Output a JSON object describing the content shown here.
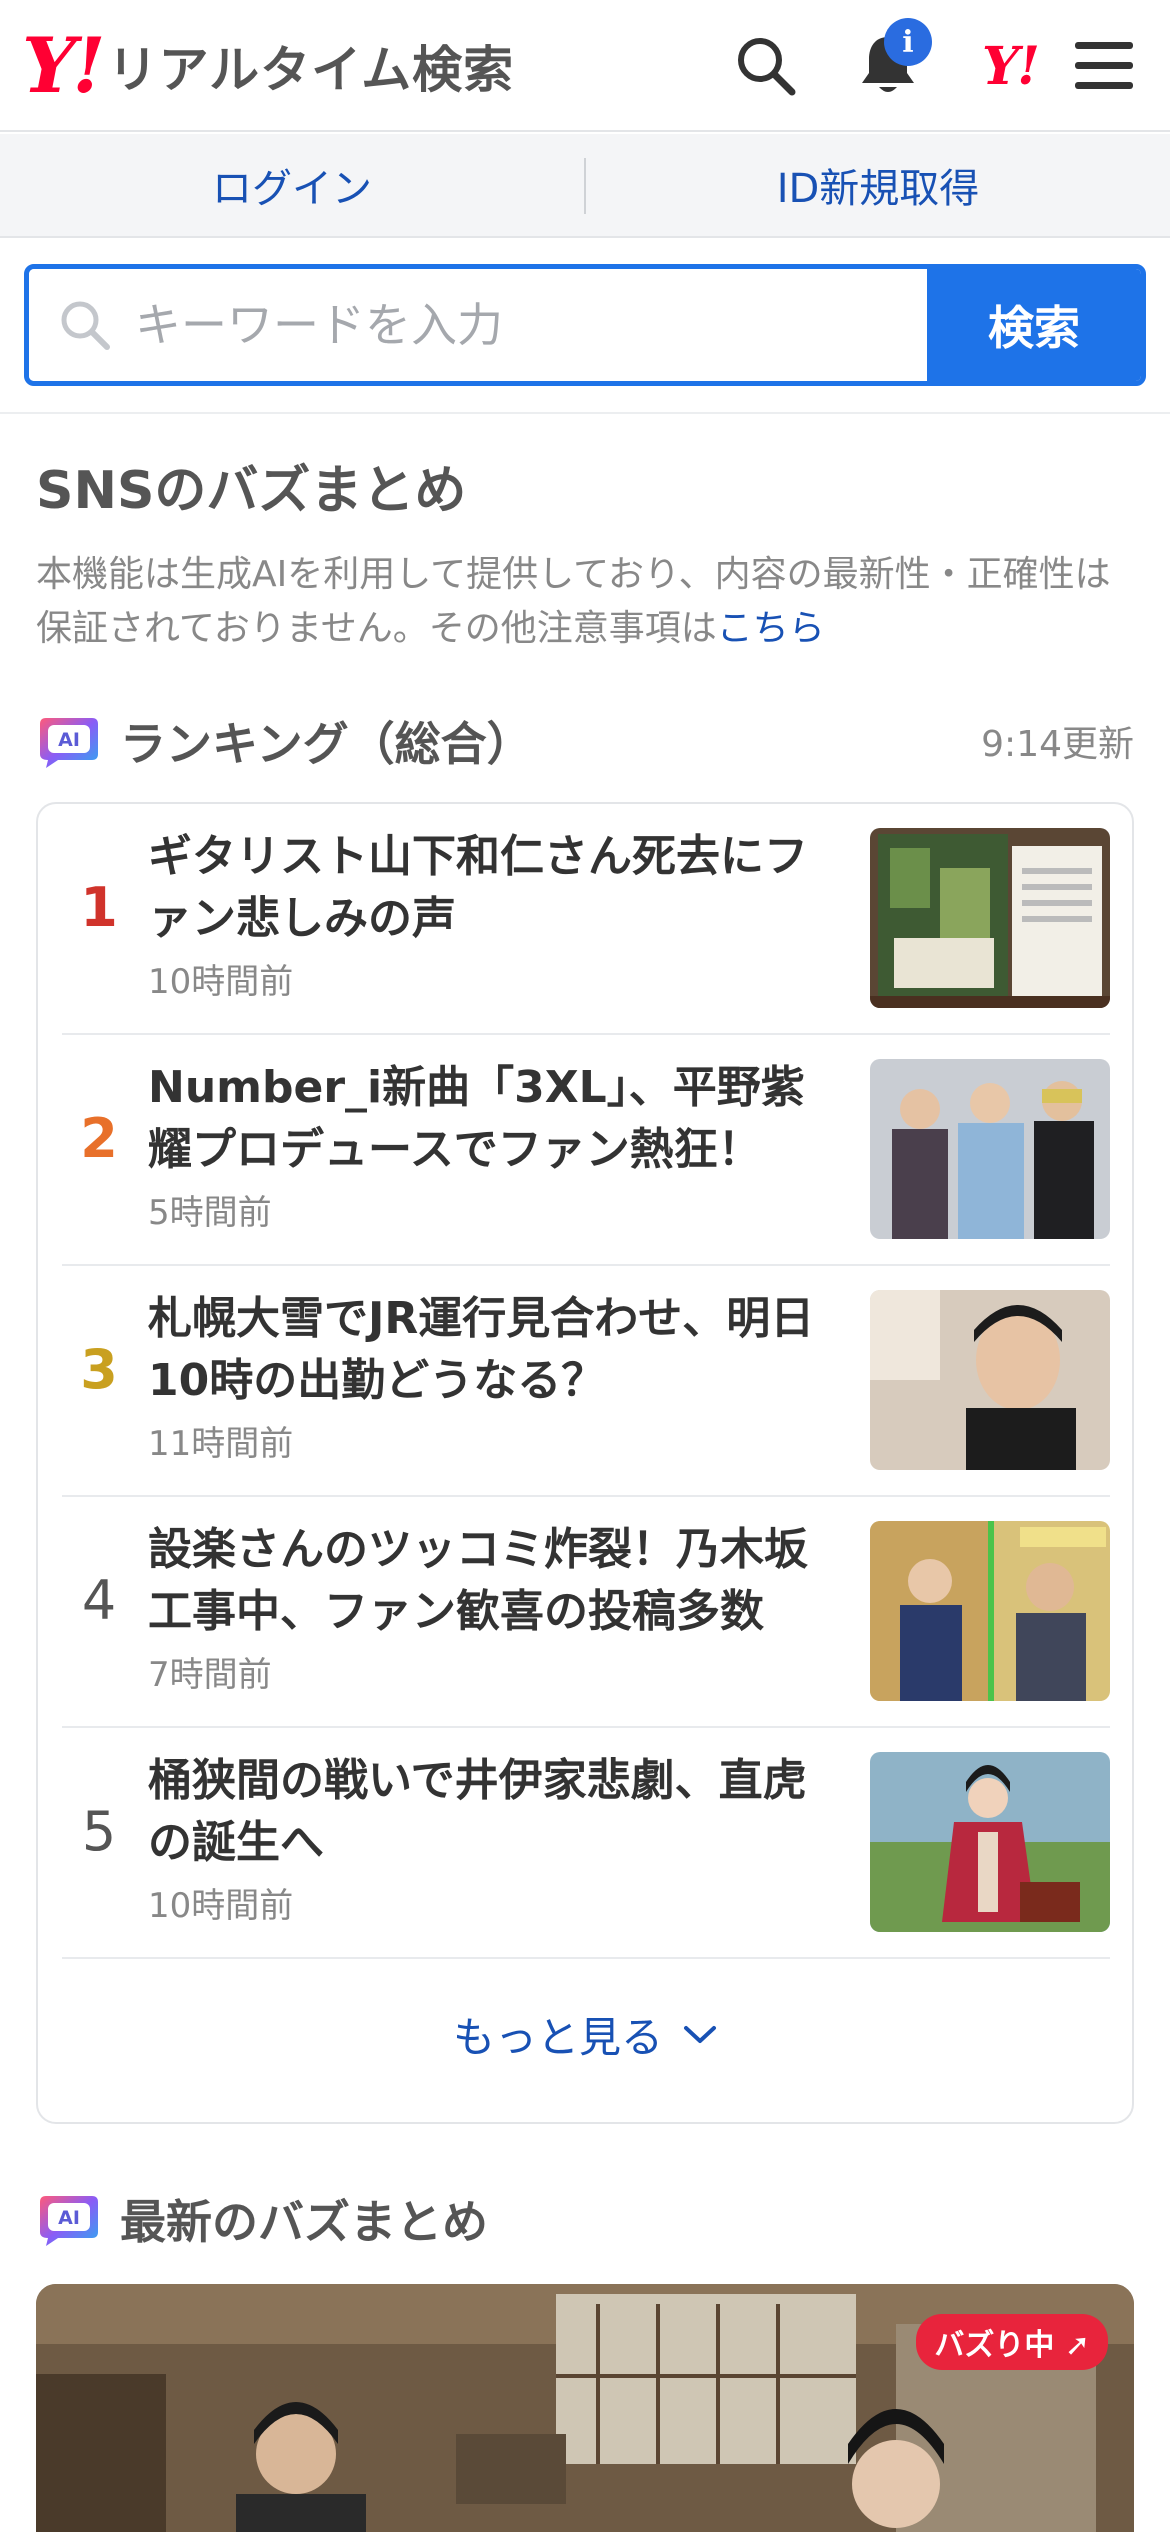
{
  "header": {
    "logo_mark": "Y!",
    "title": "リアルタイム検索",
    "notification_badge": "i",
    "yahoo_mark": "Y!"
  },
  "loginbar": {
    "login": "ログイン",
    "register": "ID新規取得"
  },
  "search": {
    "placeholder": "キーワードを入力",
    "button": "検索"
  },
  "section": {
    "title": "SNSのバズまとめ",
    "disclaimer": "本機能は生成AIを利用して提供しており、内容の最新性・正確性は保証されておりません。その他注意事項は",
    "disclaimer_link": "こちら"
  },
  "ranking": {
    "badge": "AI",
    "title": "ランキング（総合）",
    "updated": "9:14更新",
    "items": [
      {
        "rank": "1",
        "title": "ギタリスト山下和仁さん死去にファン悲しみの声",
        "time": "10時間前",
        "rank_color": "#d0332b"
      },
      {
        "rank": "2",
        "title": "Number_i新曲「3XL」、平野紫耀プロデュースでファン熱狂！",
        "time": "5時間前",
        "rank_color": "#e8702a"
      },
      {
        "rank": "3",
        "title": "札幌大雪でJR運行見合わせ、明日10時の出勤どうなる？",
        "time": "11時間前",
        "rank_color": "#c9a020"
      },
      {
        "rank": "4",
        "title": "設楽さんのツッコミ炸裂！乃木坂工事中、ファン歓喜の投稿多数",
        "time": "7時間前",
        "rank_color": "#555555"
      },
      {
        "rank": "5",
        "title": "桶狭間の戦いで井伊家悲劇、直虎の誕生へ",
        "time": "10時間前",
        "rank_color": "#555555"
      }
    ],
    "more": "もっと見る"
  },
  "latest": {
    "badge": "AI",
    "title": "最新のバズまとめ",
    "buzz_label": "バズり中"
  },
  "colors": {
    "brand_red": "#ff0033",
    "accent_blue": "#1e73e8",
    "link_blue": "#1851b4"
  }
}
